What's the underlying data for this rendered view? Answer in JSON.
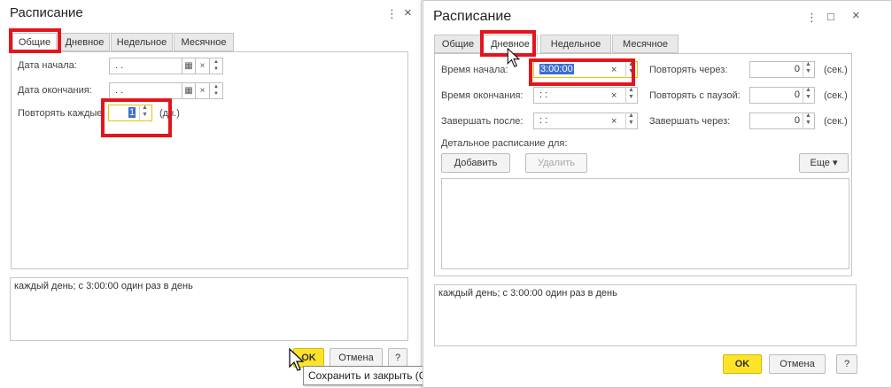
{
  "left_window": {
    "title": "Расписание",
    "tabs": [
      "Общие",
      "Дневное",
      "Недельное",
      "Месячное"
    ],
    "start_date": {
      "label": "Дата начала:",
      "value": ". ."
    },
    "end_date": {
      "label": "Дата окончания:",
      "value": ". ."
    },
    "repeat": {
      "label": "Повторять каждые:",
      "value": "1",
      "unit": "(дн.)"
    },
    "description": "каждый день; с 3:00:00 один раз в день",
    "ok_label": "OK",
    "cancel_label": "Отмена",
    "help_label": "?",
    "tooltip": "Сохранить и закрыть (С"
  },
  "right_window": {
    "title": "Расписание",
    "tabs": [
      "Общие",
      "Дневное",
      "Недельное",
      "Месячное"
    ],
    "start_time": {
      "label": "Время начала:",
      "value": "3:00:00"
    },
    "end_time": {
      "label": "Время окончания:",
      "value": ": :"
    },
    "finish_after": {
      "label": "Завершать после:",
      "value": ": :"
    },
    "repeat_every": {
      "label": "Повторять через:",
      "value": "0",
      "unit": "(сек.)"
    },
    "repeat_pause": {
      "label": "Повторять с паузой:",
      "value": "0",
      "unit": "(сек.)"
    },
    "finish_in": {
      "label": "Завершать через:",
      "value": "0",
      "unit": "(сек.)"
    },
    "detailed_label": "Детальное расписание для:",
    "add_label": "Добавить",
    "delete_label": "Удалить",
    "more_label": "Еще",
    "description": "каждый день; с 3:00:00 один раз в день",
    "ok_label": "OK",
    "cancel_label": "Отмена",
    "help_label": "?"
  },
  "icons": {
    "more_menu": "⋮",
    "close": "×",
    "maximize": "□",
    "calendar": "▦",
    "clear": "×",
    "spin_up": "▲",
    "spin_down": "▼",
    "dropdown": "▾"
  }
}
